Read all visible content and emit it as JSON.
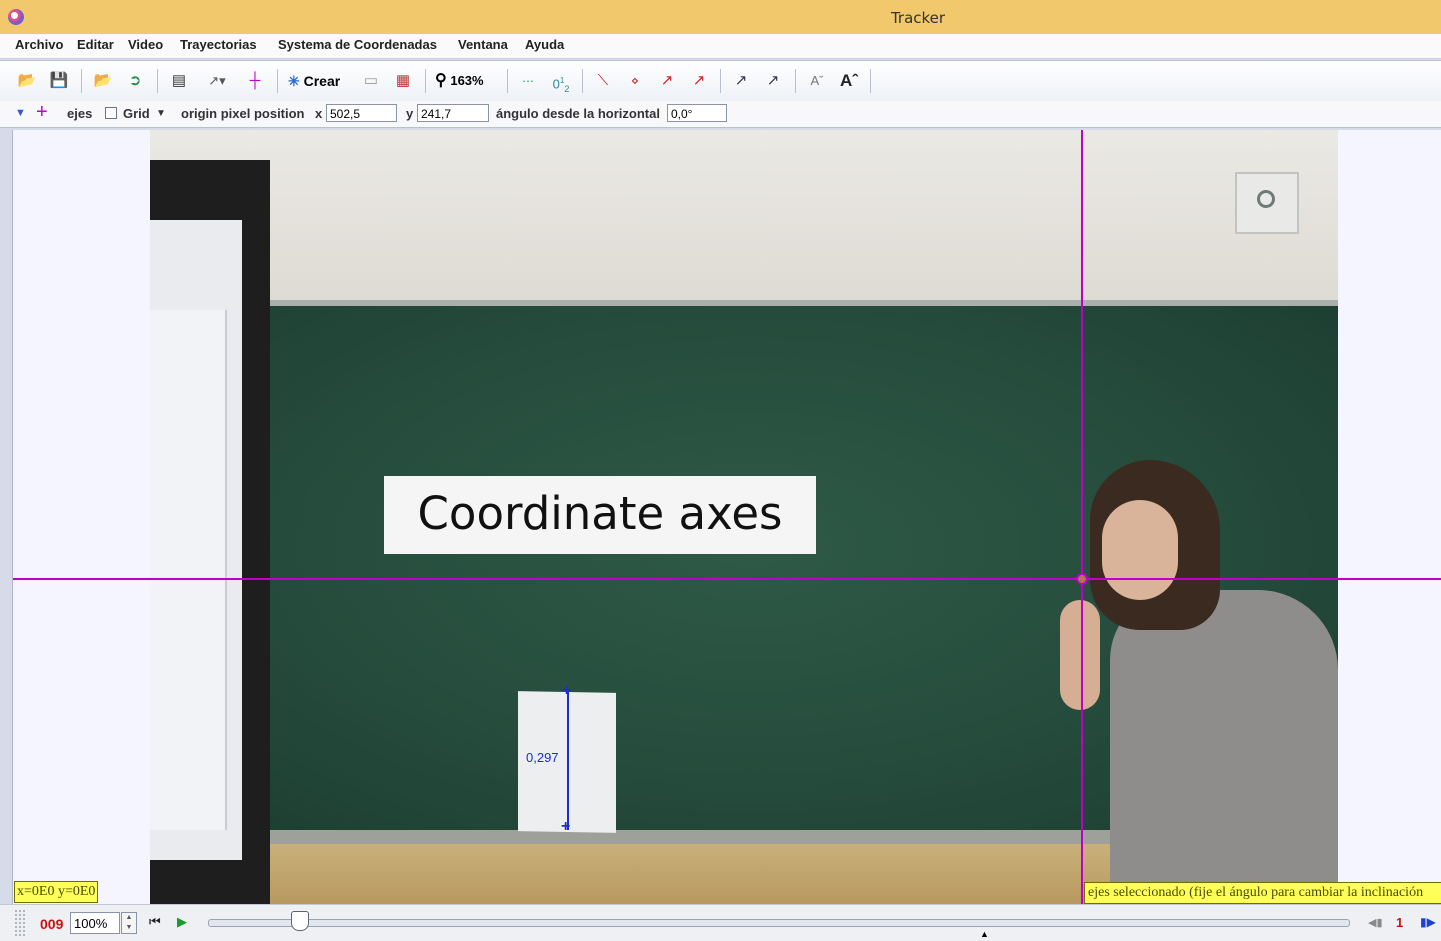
{
  "window": {
    "title": "Tracker"
  },
  "menu": [
    "Archivo",
    "Editar",
    "Video",
    "Trayectorias",
    "Systema de Coordenadas",
    "Ventana",
    "Ayuda"
  ],
  "toolbar": {
    "create_label": "Crear",
    "zoom_label": "163%"
  },
  "properties": {
    "track_name": "ejes",
    "grid_label": "Grid",
    "origin_label": "origin pixel position",
    "x_label": "x",
    "x_value": "502,5",
    "y_label": "y",
    "y_value": "241,7",
    "angle_label": "ángulo desde la horizontal",
    "angle_value": "0,0°"
  },
  "video": {
    "caption": "Coordinate axes",
    "tape_measure_value": "0,297",
    "readout": "x=0E0  y=0E0",
    "status_text": "ejes seleccionado (fije el ángulo para cambiar la inclinación"
  },
  "player": {
    "frame": "009",
    "rate": "100%",
    "step_size": "1",
    "slider_position": 0.08
  },
  "colors": {
    "axes": "#c000c8",
    "tape": "#1c2bd6",
    "title_bar": "#f1c86b",
    "status_bg": "#ffff5a"
  }
}
